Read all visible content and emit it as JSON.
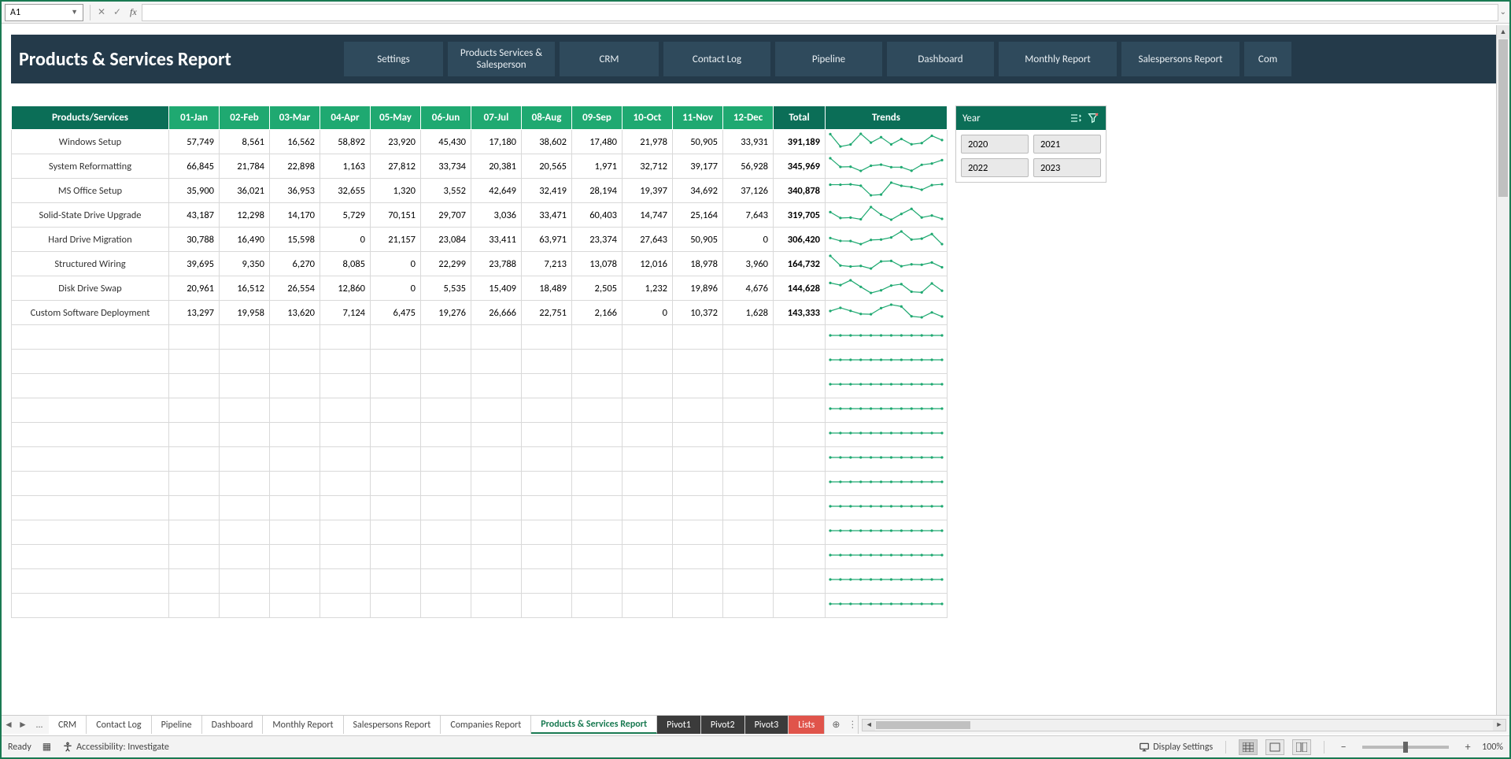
{
  "formula_bar": {
    "name_box": "A1",
    "fx_label": "fx"
  },
  "banner": {
    "title": "Products & Services Report",
    "nav": [
      "Settings",
      "Products Services & Salesperson",
      "CRM",
      "Contact Log",
      "Pipeline",
      "Dashboard",
      "Monthly Report",
      "Salespersons Report",
      "Com"
    ]
  },
  "table": {
    "headers": [
      "Products/Services",
      "01-Jan",
      "02-Feb",
      "03-Mar",
      "04-Apr",
      "05-May",
      "06-Jun",
      "07-Jul",
      "08-Aug",
      "09-Sep",
      "10-Oct",
      "11-Nov",
      "12-Dec",
      "Total",
      "Trends"
    ],
    "rows": [
      {
        "name": "Windows Setup",
        "vals": [
          "57,749",
          "8,561",
          "16,562",
          "58,892",
          "23,920",
          "45,430",
          "17,180",
          "38,602",
          "17,480",
          "21,978",
          "50,905",
          "33,931"
        ],
        "total": "391,189",
        "spark": [
          57749,
          8561,
          16562,
          58892,
          23920,
          45430,
          17180,
          38602,
          17480,
          21978,
          50905,
          33931
        ]
      },
      {
        "name": "System Reformatting",
        "vals": [
          "66,845",
          "21,784",
          "22,898",
          "1,163",
          "27,812",
          "33,734",
          "20,381",
          "20,565",
          "1,971",
          "32,712",
          "39,177",
          "56,928"
        ],
        "total": "345,969",
        "spark": [
          66845,
          21784,
          22898,
          1163,
          27812,
          33734,
          20381,
          20565,
          1971,
          32712,
          39177,
          56928
        ]
      },
      {
        "name": "MS Office Setup",
        "vals": [
          "35,900",
          "36,021",
          "36,953",
          "32,655",
          "1,320",
          "3,552",
          "42,649",
          "32,419",
          "28,194",
          "19,397",
          "34,692",
          "37,126"
        ],
        "total": "340,878",
        "spark": [
          35900,
          36021,
          36953,
          32655,
          1320,
          3552,
          42649,
          32419,
          28194,
          19397,
          34692,
          37126
        ]
      },
      {
        "name": "Solid-State Drive Upgrade",
        "vals": [
          "43,187",
          "12,298",
          "14,170",
          "5,729",
          "70,151",
          "29,707",
          "3,036",
          "33,471",
          "60,403",
          "14,747",
          "25,164",
          "7,643"
        ],
        "total": "319,705",
        "spark": [
          43187,
          12298,
          14170,
          5729,
          70151,
          29707,
          3036,
          33471,
          60403,
          14747,
          25164,
          7643
        ]
      },
      {
        "name": "Hard Drive Migration",
        "vals": [
          "30,788",
          "16,490",
          "15,598",
          "0",
          "21,157",
          "23,084",
          "33,411",
          "63,971",
          "23,374",
          "27,643",
          "50,905",
          "0"
        ],
        "total": "306,420",
        "spark": [
          30788,
          16490,
          15598,
          0,
          21157,
          23084,
          33411,
          63971,
          23374,
          27643,
          50905,
          0
        ]
      },
      {
        "name": "Structured Wiring",
        "vals": [
          "39,695",
          "9,350",
          "6,270",
          "8,085",
          "0",
          "22,299",
          "23,788",
          "7,213",
          "13,078",
          "12,016",
          "18,978",
          "3,960"
        ],
        "total": "164,732",
        "spark": [
          39695,
          9350,
          6270,
          8085,
          0,
          22299,
          23788,
          7213,
          13078,
          12016,
          18978,
          3960
        ]
      },
      {
        "name": "Disk Drive Swap",
        "vals": [
          "20,961",
          "16,512",
          "26,554",
          "12,860",
          "0",
          "5,535",
          "15,409",
          "18,489",
          "2,505",
          "1,232",
          "19,896",
          "4,676"
        ],
        "total": "144,628",
        "spark": [
          20961,
          16512,
          26554,
          12860,
          0,
          5535,
          15409,
          18489,
          2505,
          1232,
          19896,
          4676
        ]
      },
      {
        "name": "Custom Software Deployment",
        "vals": [
          "13,297",
          "19,958",
          "13,620",
          "7,124",
          "6,475",
          "19,276",
          "26,666",
          "22,751",
          "2,166",
          "0",
          "10,372",
          "1,628"
        ],
        "total": "143,333",
        "spark": [
          13297,
          19958,
          13620,
          7124,
          6475,
          19276,
          26666,
          22751,
          2166,
          0,
          10372,
          1628
        ]
      }
    ],
    "empty_rows": 12
  },
  "slicer": {
    "title": "Year",
    "items": [
      "2020",
      "2021",
      "2022",
      "2023"
    ]
  },
  "tabs": {
    "ellipsis": "...",
    "list": [
      {
        "label": "CRM",
        "style": "normal"
      },
      {
        "label": "Contact Log",
        "style": "normal"
      },
      {
        "label": "Pipeline",
        "style": "normal"
      },
      {
        "label": "Dashboard",
        "style": "normal"
      },
      {
        "label": "Monthly Report",
        "style": "normal"
      },
      {
        "label": "Salespersons Report",
        "style": "normal"
      },
      {
        "label": "Companies Report",
        "style": "normal"
      },
      {
        "label": "Products & Services Report",
        "style": "active"
      },
      {
        "label": "Pivot1",
        "style": "dark"
      },
      {
        "label": "Pivot2",
        "style": "dark"
      },
      {
        "label": "Pivot3",
        "style": "dark"
      },
      {
        "label": "Lists",
        "style": "red"
      }
    ]
  },
  "status": {
    "ready": "Ready",
    "accessibility": "Accessibility: Investigate",
    "display_settings": "Display Settings",
    "zoom": "100%"
  },
  "chart_data": {
    "type": "table",
    "title": "Products & Services Report — monthly totals",
    "columns": [
      "01-Jan",
      "02-Feb",
      "03-Mar",
      "04-Apr",
      "05-May",
      "06-Jun",
      "07-Jul",
      "08-Aug",
      "09-Sep",
      "10-Oct",
      "11-Nov",
      "12-Dec",
      "Total"
    ],
    "rows": [
      {
        "name": "Windows Setup",
        "values": [
          57749,
          8561,
          16562,
          58892,
          23920,
          45430,
          17180,
          38602,
          17480,
          21978,
          50905,
          33931,
          391189
        ]
      },
      {
        "name": "System Reformatting",
        "values": [
          66845,
          21784,
          22898,
          1163,
          27812,
          33734,
          20381,
          20565,
          1971,
          32712,
          39177,
          56928,
          345969
        ]
      },
      {
        "name": "MS Office Setup",
        "values": [
          35900,
          36021,
          36953,
          32655,
          1320,
          3552,
          42649,
          32419,
          28194,
          19397,
          34692,
          37126,
          340878
        ]
      },
      {
        "name": "Solid-State Drive Upgrade",
        "values": [
          43187,
          12298,
          14170,
          5729,
          70151,
          29707,
          3036,
          33471,
          60403,
          14747,
          25164,
          7643,
          319705
        ]
      },
      {
        "name": "Hard Drive Migration",
        "values": [
          30788,
          16490,
          15598,
          0,
          21157,
          23084,
          33411,
          63971,
          23374,
          27643,
          50905,
          0,
          306420
        ]
      },
      {
        "name": "Structured Wiring",
        "values": [
          39695,
          9350,
          6270,
          8085,
          0,
          22299,
          23788,
          7213,
          13078,
          12016,
          18978,
          3960,
          164732
        ]
      },
      {
        "name": "Disk Drive Swap",
        "values": [
          20961,
          16512,
          26554,
          12860,
          0,
          5535,
          15409,
          18489,
          2505,
          1232,
          19896,
          4676,
          144628
        ]
      },
      {
        "name": "Custom Software Deployment",
        "values": [
          13297,
          19958,
          13620,
          7124,
          6475,
          19276,
          26666,
          22751,
          2166,
          0,
          10372,
          1628,
          143333
        ]
      }
    ]
  }
}
